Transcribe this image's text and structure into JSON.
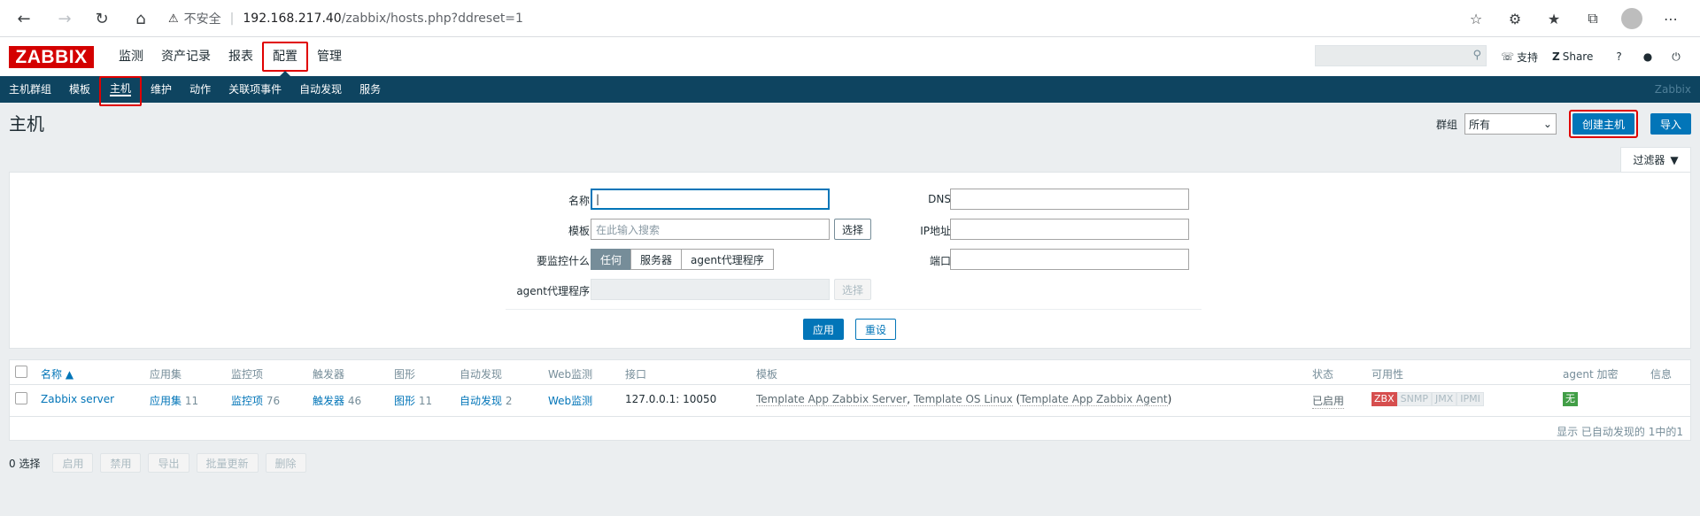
{
  "browser": {
    "security_label": "不安全",
    "url_host": "192.168.217.40",
    "url_path": "/zabbix/hosts.php?ddreset=1"
  },
  "header": {
    "logo": "ZABBIX",
    "menu": [
      "监测",
      "资产记录",
      "报表",
      "配置",
      "管理"
    ],
    "selected_menu": "配置",
    "support": "支持",
    "share": "Share",
    "help": "?"
  },
  "submenu": {
    "items": [
      "主机群组",
      "模板",
      "主机",
      "维护",
      "动作",
      "关联项事件",
      "自动发现",
      "服务"
    ],
    "active": "主机",
    "brand": "Zabbix"
  },
  "page": {
    "title": "主机",
    "group_label": "群组",
    "group_value": "所有",
    "create_button": "创建主机",
    "import_button": "导入"
  },
  "filter": {
    "tab_label": "过滤器",
    "name_label": "名称",
    "template_label": "模板",
    "template_placeholder": "在此输入搜索",
    "select_button": "选择",
    "monitor_label": "要监控什么",
    "monitor_options": [
      "任何",
      "服务器",
      "agent代理程序"
    ],
    "proxy_label": "agent代理程序",
    "proxy_select_button": "选择",
    "dns_label": "DNS",
    "ip_label": "IP地址",
    "port_label": "端口",
    "apply": "应用",
    "reset": "重设"
  },
  "table": {
    "headers": [
      "名称 ▲",
      "应用集",
      "监控项",
      "触发器",
      "图形",
      "自动发现",
      "Web监测",
      "接口",
      "模板",
      "状态",
      "可用性",
      "agent 加密",
      "信息"
    ],
    "rows": [
      {
        "name": "Zabbix server",
        "apps_label": "应用集",
        "apps_count": "11",
        "items_label": "监控项",
        "items_count": "76",
        "triggers_label": "触发器",
        "triggers_count": "46",
        "graphs_label": "图形",
        "graphs_count": "11",
        "discovery_label": "自动发现",
        "discovery_count": "2",
        "web": "Web监测",
        "interface": "127.0.0.1: 10050",
        "templates_a": "Template App Zabbix Server",
        "templates_sep": ", ",
        "templates_b": "Template OS Linux",
        "templates_paren_open": " (",
        "templates_c": "Template App Zabbix Agent",
        "templates_paren_close": ")",
        "status": "已启用",
        "availability": [
          "ZBX",
          "SNMP",
          "JMX",
          "IPMI"
        ],
        "encryption": "无"
      }
    ],
    "footer": "显示 已自动发现的 1中的1"
  },
  "actions": {
    "selected_count": "0 选择",
    "buttons": [
      "启用",
      "禁用",
      "导出",
      "批量更新",
      "删除"
    ]
  },
  "colors": {
    "accent": "#0275b8",
    "nav_dark": "#0e4460",
    "logo_red": "#d40000",
    "highlight_red": "#e00000"
  }
}
